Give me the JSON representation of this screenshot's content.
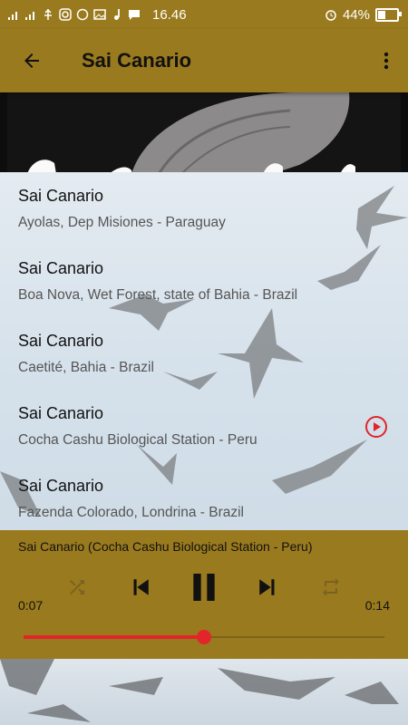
{
  "status_bar": {
    "time": "16.46",
    "battery": "44%",
    "battery_level": 0.44
  },
  "app_bar": {
    "title": "Sai Canario"
  },
  "tracks": [
    {
      "title": "Sai Canario",
      "location": "Ayolas, Dep Misiones - Paraguay",
      "playing": false
    },
    {
      "title": "Sai Canario",
      "location": "Boa Nova, Wet Forest, state of Bahia - Brazil",
      "playing": false
    },
    {
      "title": "Sai Canario",
      "location": "Caetité, Bahia - Brazil",
      "playing": false
    },
    {
      "title": "Sai Canario",
      "location": "Cocha Cashu Biological Station - Peru",
      "playing": true
    },
    {
      "title": "Sai Canario",
      "location": "Fazenda Colorado, Londrina - Brazil",
      "playing": false
    }
  ],
  "player": {
    "now_playing": "Sai Canario (Cocha Cashu Biological Station - Peru)",
    "elapsed": "0:07",
    "duration": "0:14",
    "progress": 0.5
  },
  "colors": {
    "bar": "#9a7a1e",
    "accent": "#e3242b"
  },
  "icons": {
    "back": "arrow-left-icon",
    "overflow": "more-vert-icon",
    "play": "play-circle-icon",
    "shuffle": "shuffle-icon",
    "prev": "skip-previous-icon",
    "pause": "pause-icon",
    "next": "skip-next-icon",
    "repeat": "repeat-icon"
  }
}
